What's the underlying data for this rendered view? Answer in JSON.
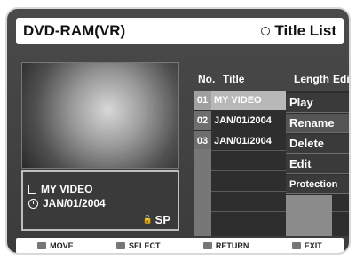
{
  "header": {
    "left_title": "DVD-RAM(VR)",
    "right_title": "Title List"
  },
  "info": {
    "title": "MY VIDEO",
    "date": "JAN/01/2004",
    "quality": "SP"
  },
  "columns": {
    "no": "No.",
    "title": "Title",
    "length": "Length",
    "edit": "Edit"
  },
  "rows": [
    {
      "no": "01",
      "title": "MY VIDEO"
    },
    {
      "no": "02",
      "title": "JAN/01/2004"
    },
    {
      "no": "03",
      "title": "JAN/01/2004"
    }
  ],
  "menu": {
    "play": "Play",
    "rename": "Rename",
    "delete": "Delete",
    "edit": "Edit",
    "protection": "Protection"
  },
  "footer": {
    "move": "MOVE",
    "select": "SELECT",
    "return": "RETURN",
    "exit": "EXIT"
  }
}
